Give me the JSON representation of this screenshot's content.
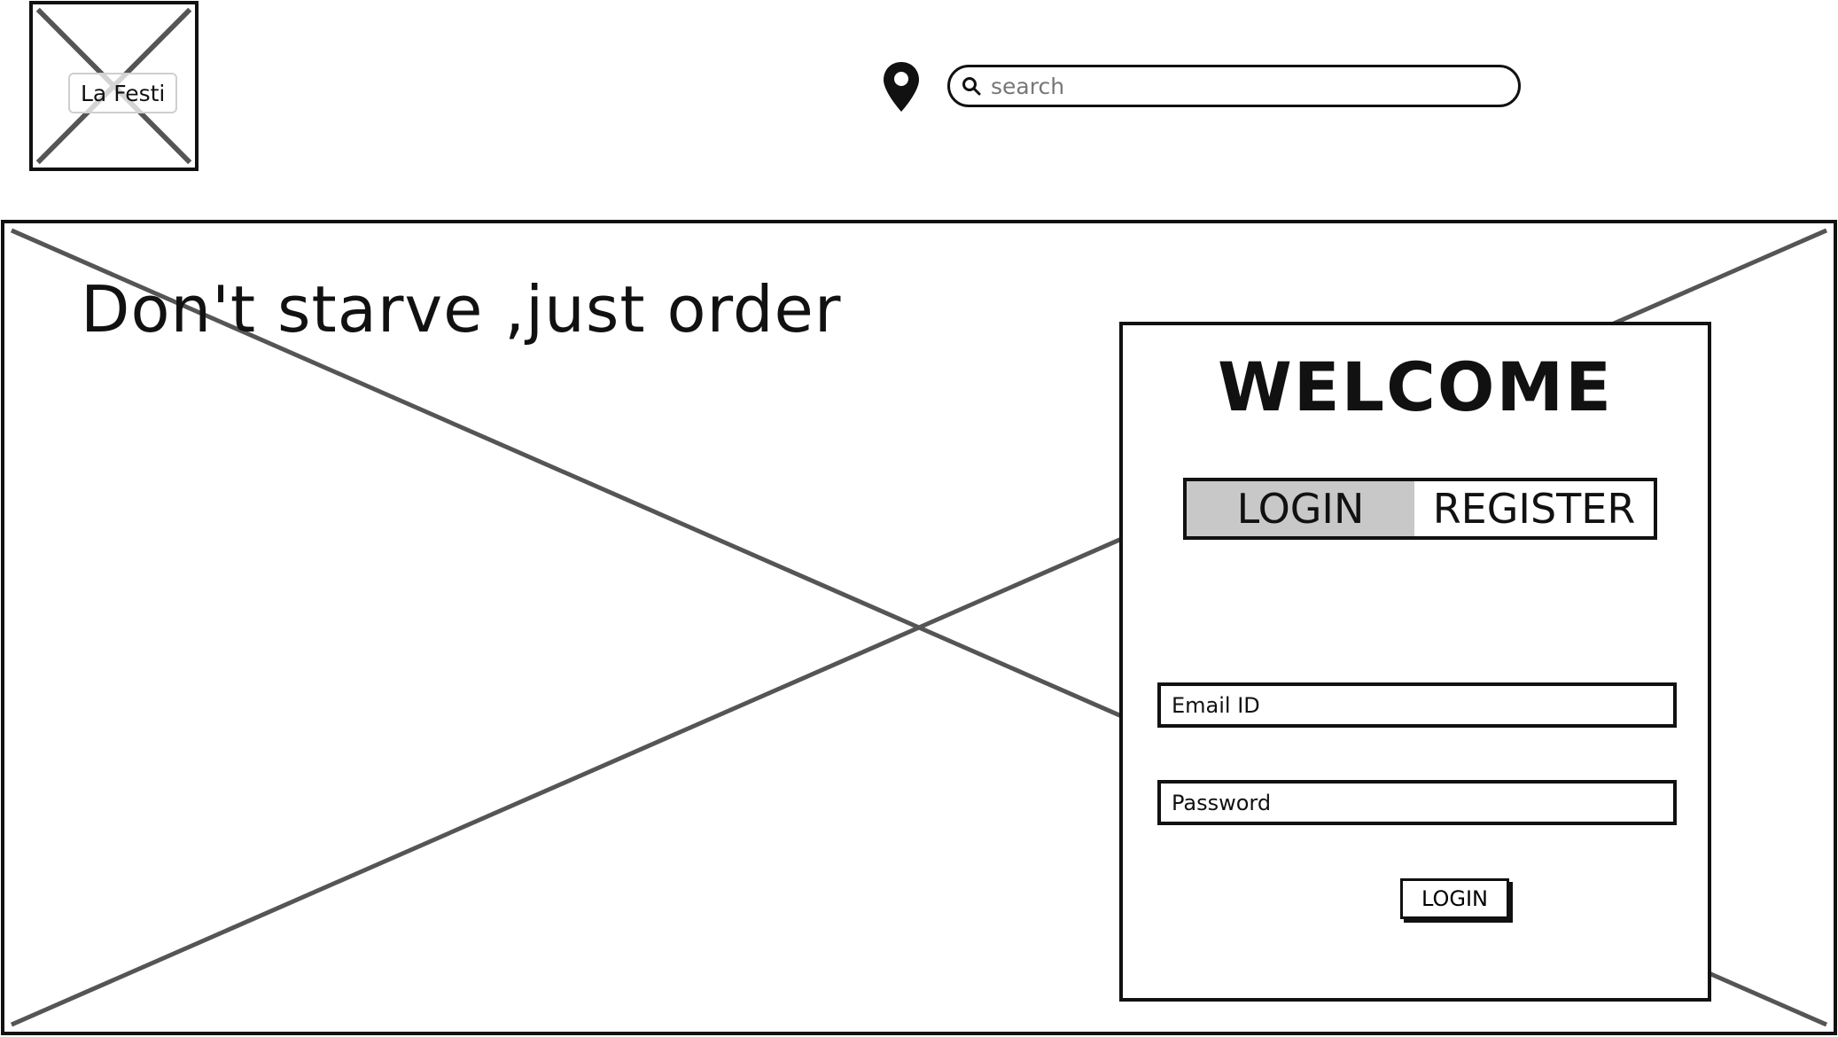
{
  "brand": {
    "logo_label": "La Festi"
  },
  "header": {
    "search_placeholder": "search",
    "icons": {
      "location": "location-pin-icon",
      "search": "search-icon"
    }
  },
  "hero": {
    "headline": "Don't starve ,just order"
  },
  "login_card": {
    "title": "WELCOME",
    "tabs": [
      {
        "label": "LOGIN",
        "active": true
      },
      {
        "label": "REGISTER",
        "active": false
      }
    ],
    "email_placeholder": "Email ID",
    "password_placeholder": "Password",
    "submit_label": "LOGIN"
  },
  "colors": {
    "stroke": "#111111",
    "placeholder_lines": "#555555",
    "active_tab": "#c8c8c8",
    "background": "#ffffff"
  }
}
